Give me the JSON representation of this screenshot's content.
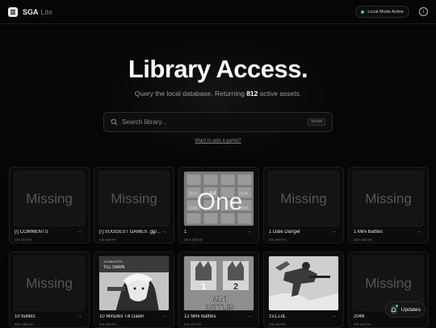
{
  "brand": {
    "name": "SGA",
    "sub": "Lite"
  },
  "status": {
    "label": "Local Mode Active",
    "color": "#2fd27a"
  },
  "hero": {
    "title": "Library Access.",
    "subtitle_prefix": "Query the local database. Returning",
    "asset_count": "812",
    "subtitle_suffix": "active assets."
  },
  "search": {
    "placeholder": "Search library...",
    "shortcut": "ENTER"
  },
  "add_link": "Want to add a game?",
  "missing_label": "Missing",
  "cards": [
    {
      "title": "[!] COMMENTS",
      "author": "GN MATH",
      "thumb": "missing"
    },
    {
      "title": "[!] SUGGEST GAMES .gg/...",
      "author": "GN MATH",
      "thumb": "missing"
    },
    {
      "title": "1",
      "author": "SEA BEAN",
      "thumb": "one",
      "thumb_text": "One",
      "tile_numbers": [
        "1024",
        "64",
        "2048",
        "2048",
        "2048"
      ]
    },
    {
      "title": "1 Date Danger",
      "author": "GN MATH",
      "thumb": "missing"
    },
    {
      "title": "1 Mini Battles",
      "author": "SEA BEAN",
      "thumb": "missing"
    },
    {
      "title": "10 bullets",
      "author": "SEA BEAN",
      "thumb": "missing"
    },
    {
      "title": "10 Minutes Till Dawn",
      "author": "GN MATH",
      "thumb": "dawn",
      "thumb_text": "TILL DAWN",
      "thumb_text_big": "10 MINUTES"
    },
    {
      "title": "12 Mini Battles",
      "author": "GN MATH",
      "thumb": "battles",
      "thumb_text": "MINI",
      "thumb_text2": "BATTLES",
      "num1": "1",
      "num2": "2"
    },
    {
      "title": "1v1.LoL",
      "author": "GN MATH",
      "thumb": "lol"
    },
    {
      "title": "2048",
      "author": "GN MATH",
      "thumb": "missing"
    }
  ],
  "updates": {
    "label": "Updates"
  }
}
